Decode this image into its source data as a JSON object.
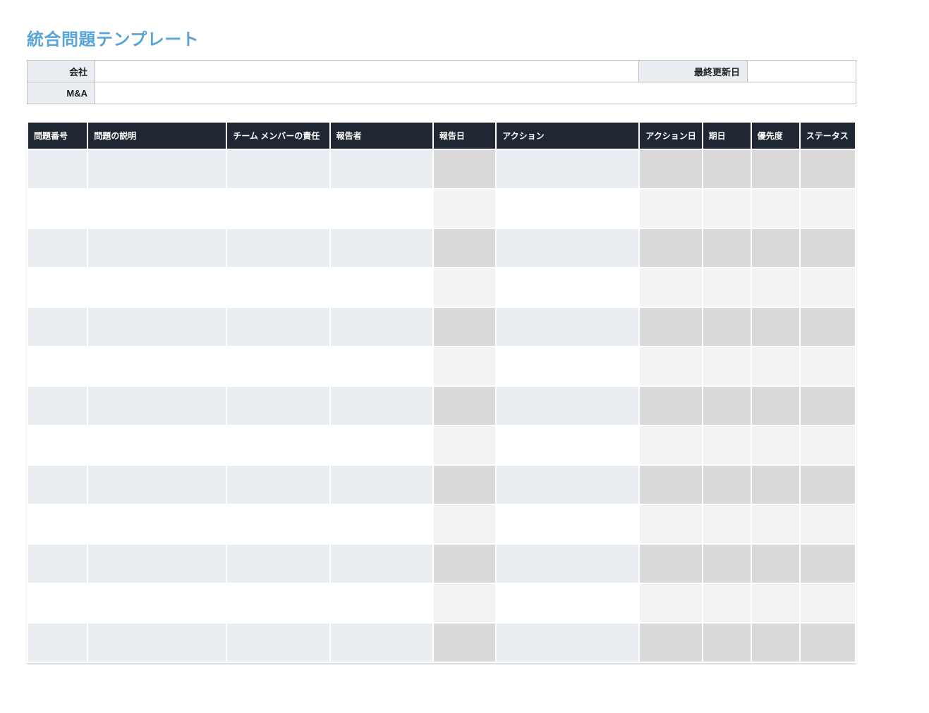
{
  "title": "統合問題テンプレート",
  "info": {
    "company_label": "会社",
    "company_value": "",
    "updated_label": "最終更新日",
    "updated_value": "",
    "ma_label": "M&A",
    "ma_value": ""
  },
  "issues": {
    "headers": {
      "no": "問題番号",
      "desc": "問題の説明",
      "team": "チーム メンバーの責任",
      "reporter": "報告者",
      "repdate": "報告日",
      "action": "アクション",
      "actdate": "アクション日",
      "duedate": "期日",
      "priority": "優先度",
      "status": "ステータス"
    },
    "rows": [
      {
        "no": "",
        "desc": "",
        "team": "",
        "reporter": "",
        "repdate": "",
        "action": "",
        "actdate": "",
        "duedate": "",
        "priority": "",
        "status": ""
      },
      {
        "no": "",
        "desc": "",
        "team": "",
        "reporter": "",
        "repdate": "",
        "action": "",
        "actdate": "",
        "duedate": "",
        "priority": "",
        "status": ""
      },
      {
        "no": "",
        "desc": "",
        "team": "",
        "reporter": "",
        "repdate": "",
        "action": "",
        "actdate": "",
        "duedate": "",
        "priority": "",
        "status": ""
      },
      {
        "no": "",
        "desc": "",
        "team": "",
        "reporter": "",
        "repdate": "",
        "action": "",
        "actdate": "",
        "duedate": "",
        "priority": "",
        "status": ""
      },
      {
        "no": "",
        "desc": "",
        "team": "",
        "reporter": "",
        "repdate": "",
        "action": "",
        "actdate": "",
        "duedate": "",
        "priority": "",
        "status": ""
      },
      {
        "no": "",
        "desc": "",
        "team": "",
        "reporter": "",
        "repdate": "",
        "action": "",
        "actdate": "",
        "duedate": "",
        "priority": "",
        "status": ""
      },
      {
        "no": "",
        "desc": "",
        "team": "",
        "reporter": "",
        "repdate": "",
        "action": "",
        "actdate": "",
        "duedate": "",
        "priority": "",
        "status": ""
      },
      {
        "no": "",
        "desc": "",
        "team": "",
        "reporter": "",
        "repdate": "",
        "action": "",
        "actdate": "",
        "duedate": "",
        "priority": "",
        "status": ""
      },
      {
        "no": "",
        "desc": "",
        "team": "",
        "reporter": "",
        "repdate": "",
        "action": "",
        "actdate": "",
        "duedate": "",
        "priority": "",
        "status": ""
      },
      {
        "no": "",
        "desc": "",
        "team": "",
        "reporter": "",
        "repdate": "",
        "action": "",
        "actdate": "",
        "duedate": "",
        "priority": "",
        "status": ""
      },
      {
        "no": "",
        "desc": "",
        "team": "",
        "reporter": "",
        "repdate": "",
        "action": "",
        "actdate": "",
        "duedate": "",
        "priority": "",
        "status": ""
      },
      {
        "no": "",
        "desc": "",
        "team": "",
        "reporter": "",
        "repdate": "",
        "action": "",
        "actdate": "",
        "duedate": "",
        "priority": "",
        "status": ""
      },
      {
        "no": "",
        "desc": "",
        "team": "",
        "reporter": "",
        "repdate": "",
        "action": "",
        "actdate": "",
        "duedate": "",
        "priority": "",
        "status": ""
      }
    ]
  }
}
